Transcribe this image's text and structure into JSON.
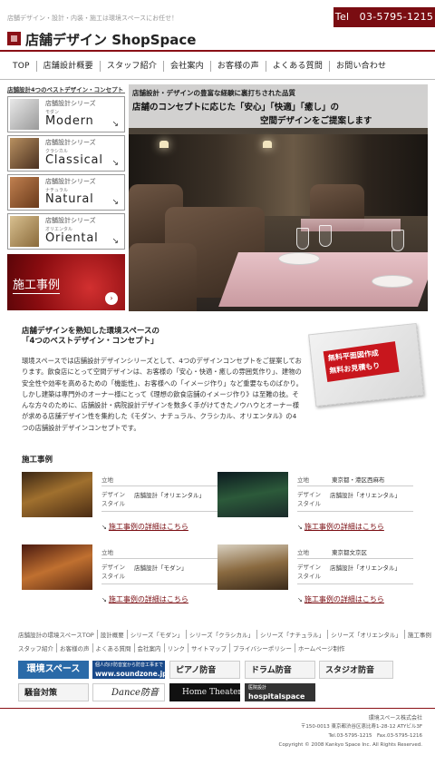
{
  "header": {
    "tagline": "店舗デザイン・設計・内装・施工は環境スペースにお任せ！",
    "tel": "Tel　03-5795-1215",
    "logo": "店舗デザイン ShopSpace"
  },
  "nav": [
    "TOP",
    "店舗設計概要",
    "スタッフ紹介",
    "会社案内",
    "お客様の声",
    "よくある質問",
    "お問い合わせ"
  ],
  "sidebar": {
    "title": "店舗設計4つのベストデザイン・コンセプト",
    "series": [
      {
        "small": "店舗設計シリーズ",
        "kana": "モダン",
        "big": "Modern",
        "color": "#c8c8c8"
      },
      {
        "small": "店舗設計シリーズ",
        "kana": "クラシカル",
        "big": "Classical",
        "color": "#7a5a3a"
      },
      {
        "small": "店舗設計シリーズ",
        "kana": "ナチュラル",
        "big": "Natural",
        "color": "#9a6a3a"
      },
      {
        "small": "店舗設計シリーズ",
        "kana": "オリエンタル",
        "big": "Oriental",
        "color": "#b79a5e"
      }
    ],
    "arrow": "↘",
    "works_label": "施工事例",
    "works_arrow": "›"
  },
  "hero": {
    "caption1": "店舗設計・デザインの豊富な経験に裏打ちされた品質",
    "caption2": "店舗のコンセプトに応じた「安心」「快適」「癒し」の",
    "caption3": "空間デザインをご提案します"
  },
  "intro": {
    "title1": "店舗デザインを熟知した環境スペースの",
    "title2": "「4つのベストデザイン・コンセプト」",
    "body": "環境スペースでは店舗設計デザインシリーズとして、4つのデザインコンセプトをご提案しております。飲食店にとって空間デザインは、お客様の「安心・快適・癒しの雰囲気作り」、建物の安全性や効率を高めるための「機能性」、お客様への「イメージ作り」など重要なものばかり。しかし建築は専門外のオーナー様にとって《理想の飲食店舗のイメージ作り》は至難の技。そんな方々のために、店舗設計・病院設計デザインを数多く手がけてきたノウハウとオーナー様が求める店舗デザイン性を集約した《モダン、ナチュラル、クラシカル、オリエンタル》の4つの店舗設計デザインコンセプトです。",
    "promo1": "無料平面図作成",
    "promo2": "無料お見積もり"
  },
  "works": {
    "title": "施工事例",
    "items": [
      {
        "place_label": "立地",
        "place": "",
        "style_label": "デザイン\nスタイル",
        "style": "店舗設計「オリエンタル」",
        "link": "施工事例の詳細はこちら"
      },
      {
        "place_label": "立地",
        "place": "東京都・港区西麻布",
        "style_label": "デザイン\nスタイル",
        "style": "店舗設計「オリエンタル」",
        "link": "施工事例の詳細はこちら"
      },
      {
        "place_label": "立地",
        "place": "",
        "style_label": "デザイン\nスタイル",
        "style": "店舗設計「モダン」",
        "link": "施工事例の詳細はこちら"
      },
      {
        "place_label": "立地",
        "place": "東京都文京区",
        "style_label": "デザイン\nスタイル",
        "style": "店舗設計「オリエンタル」",
        "link": "施工事例の詳細はこちら"
      }
    ]
  },
  "footer_links": {
    "row1": [
      "店舗設計の環境スペースTOP",
      "設計概要",
      "シリーズ「モダン」",
      "シリーズ「クラシカル」",
      "シリーズ「ナチュラル」",
      "シリーズ「オリエンタル」",
      "施工事例"
    ],
    "row2": [
      "スタッフ紹介",
      "お客様の声",
      "よくある質問",
      "会社案内",
      "リンク",
      "サイトマップ",
      "プライバシーポリシー",
      "ホームページ制作"
    ]
  },
  "banners": {
    "b1": "環境スペース",
    "b2a": "個人向け防音室から防音工事まで",
    "b2b": "www.soundzone.jp",
    "b3": "ピアノ防音",
    "b4": "ドラム防音",
    "b5": "スタジオ防音",
    "b6": "騒音対策",
    "b7": "Dance防音",
    "b8": "Home Theater",
    "b9a": "医院設計",
    "b9b": "hospitalspace"
  },
  "footer": {
    "company": "環境スペース株式会社",
    "address": "〒150-0013 東京都渋谷区恵比寿1-28-12 ATYビル3F",
    "telfax": "Tel.03-5795-1215　Fax.03-5795-1216",
    "copyright": "Copyright © 2008 Kankyo Space Inc. All Rights Reserved."
  }
}
